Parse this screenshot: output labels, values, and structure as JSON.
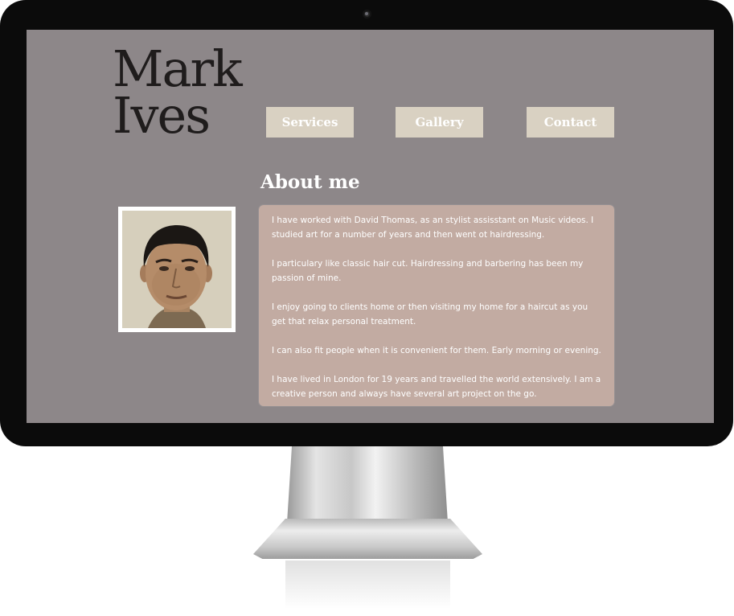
{
  "logo": {
    "line1": "Mark",
    "line2": "Ives"
  },
  "nav": {
    "services": "Services",
    "gallery": "Gallery",
    "contact": "Contact"
  },
  "about": {
    "title": "About me",
    "paragraphs": [
      "I have worked with David Thomas, as an stylist assisstant on Music videos. I studied art for a number of years and then went ot hairdressing.",
      "I particulary like classic hair cut. Hairdressing and barbering has been my passion of mine.",
      "I enjoy going to clients home or then visiting my home for a haircut as you get that relax personal treatment.",
      "I can also fit people when it is convenient for them. Early morning or evening.",
      "I have lived in London for 19 years and travelled the world extensively. I am a creative person and always have several art project on the go."
    ]
  },
  "colors": {
    "screen_bg": "#8d8789",
    "button_bg": "#d9d1c2",
    "panel_bg": "#c2aba2",
    "photo_bg": "#d6cfbc",
    "logo_text": "#1f1c1c"
  },
  "icons": {
    "camera": "webcam-icon"
  }
}
